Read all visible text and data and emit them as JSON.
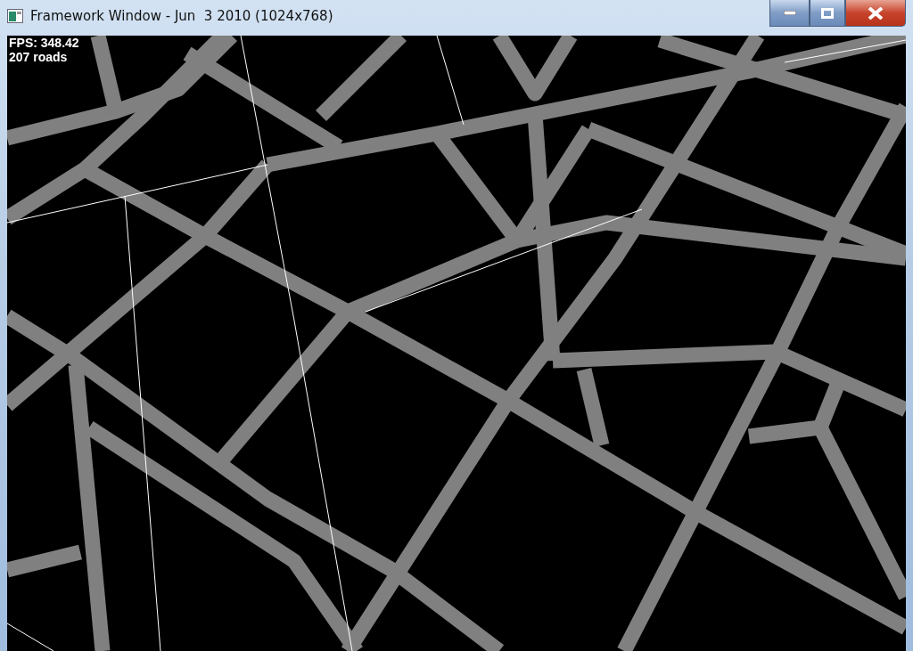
{
  "window": {
    "title": "Framework Window - Jun  3 2010 (1024x768)"
  },
  "overlay": {
    "lines": [
      "FPS: 348.42",
      "207 roads"
    ]
  }
}
